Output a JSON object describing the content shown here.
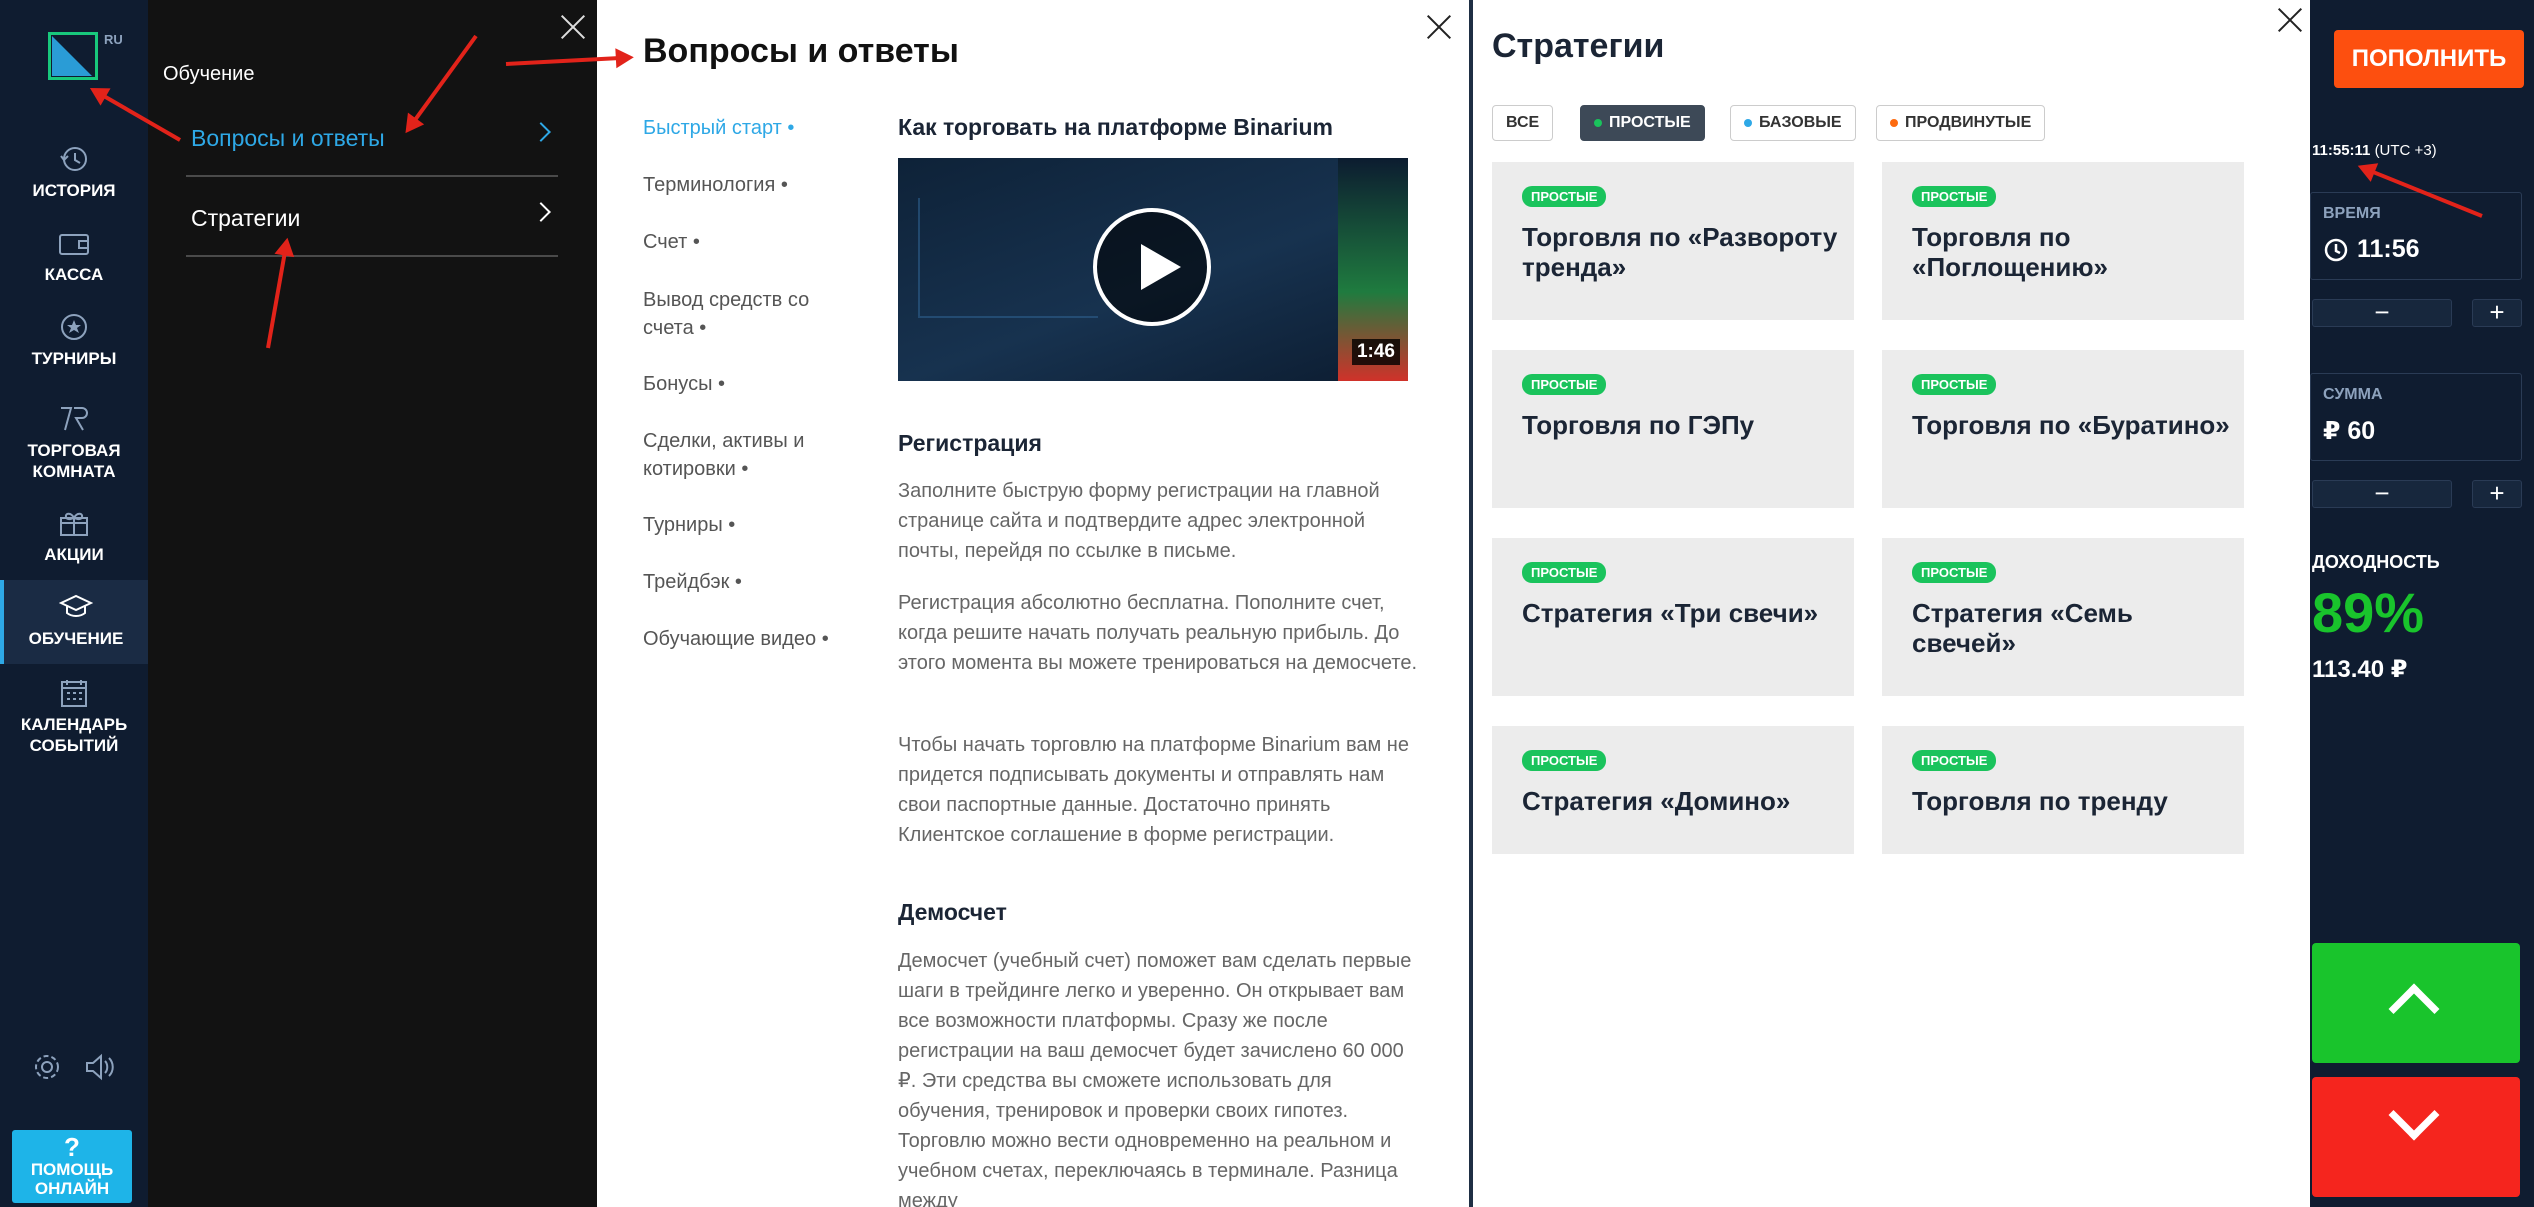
{
  "logo": {
    "badge": "RU"
  },
  "nav": {
    "items": [
      {
        "label": "ИСТОРИЯ",
        "icon": "history-icon"
      },
      {
        "label": "КАССА",
        "icon": "wallet-icon"
      },
      {
        "label": "ТУРНИРЫ",
        "icon": "star-badge-icon"
      },
      {
        "label": "ТОРГОВАЯ КОМНАТА",
        "icon": "trading-room-icon"
      },
      {
        "label": "АКЦИИ",
        "icon": "gift-icon"
      },
      {
        "label": "ОБУЧЕНИЕ",
        "icon": "graduation-cap-icon"
      },
      {
        "label": "КАЛЕНДАРЬ СОБЫТИЙ",
        "icon": "calendar-icon"
      }
    ],
    "help_label_1": "ПОМОЩЬ",
    "help_label_2": "ОНЛАЙН",
    "help_q": "?"
  },
  "learn": {
    "header": "Обучение",
    "items": [
      {
        "label": "Вопросы и ответы"
      },
      {
        "label": "Стратегии"
      }
    ]
  },
  "faq": {
    "title": "Вопросы и ответы",
    "toc": [
      "Быстрый старт •",
      "Терминология •",
      "Счет •",
      "Вывод средств со счета •",
      "Бонусы •",
      "Сделки, активы и котировки •",
      "Турниры •",
      "Трейдбэк •",
      "Обучающие видео •"
    ],
    "article_title": "Как торговать на платформе Binarium",
    "video_duration": "1:46",
    "sections": [
      {
        "title": "Регистрация"
      },
      {
        "title": "Демосчет"
      }
    ],
    "paragraphs": [
      "Заполните быструю форму регистрации на главной странице сайта и подтвердите адрес электронной почты, перейдя по ссылке в письме.",
      "Регистрация абсолютно бесплатна. Пополните счет, когда решите начать получать реальную прибыль. До этого момента вы можете тренироваться на демосчете.",
      "Чтобы начать торговлю на платформе Binarium вам не придется подписывать документы и отправлять нам свои паспортные данные. Достаточно принять Клиентское соглашение в форме регистрации.",
      "Демосчет (учебный счет) поможет вам сделать первые шаги в трейдинге легко и уверенно. Он открывает вам все возможности платформы. Сразу же после регистрации на ваш демосчет будет зачислено 60 000 ₽. Эти средства вы сможете использовать для обучения, тренировок и проверки своих гипотез. Торговлю можно вести одновременно на реальном и учебном счетах, переключаясь в терминале. Разница между"
    ]
  },
  "strategies": {
    "title": "Стратегии",
    "filters": [
      {
        "label": "ВСЕ",
        "dot": ""
      },
      {
        "label": "ПРОСТЫЕ",
        "dot": "#1ac35c"
      },
      {
        "label": "БАЗОВЫЕ",
        "dot": "#2ea8e6"
      },
      {
        "label": "ПРОДВИНУТЫЕ",
        "dot": "#fd6a0f"
      }
    ],
    "badge": "ПРОСТЫЕ",
    "cards": [
      "Торговля по «Развороту тренда»",
      "Торговля по «Поглощению»",
      "Торговля по ГЭПу",
      "Торговля по «Буратино»",
      "Стратегия «Три свечи»",
      "Стратегия «Семь свечей»",
      "Стратегия «Домино»",
      "Торговля по тренду"
    ]
  },
  "trade": {
    "topup": "ПОПОЛНИТЬ",
    "time_now": "11:55:11",
    "tz": "(UTC +3)",
    "time_caption": "ВРЕМЯ",
    "time_value": "11:56",
    "sum_caption": "СУММА",
    "sum_value": "₽ 60",
    "minus": "−",
    "plus": "+",
    "yield_caption": "ДОХОДНОСТЬ",
    "yield_value": "89%",
    "payout": "113.40 ₽"
  },
  "colors": {
    "accent": "#2ea8e6",
    "nav_bg": "#0f1c30",
    "topup": "#fd4f0f",
    "up": "#19c42c",
    "down": "#f5251e",
    "badge": "#1ac35c",
    "annotation_arrow": "#e2231a"
  }
}
